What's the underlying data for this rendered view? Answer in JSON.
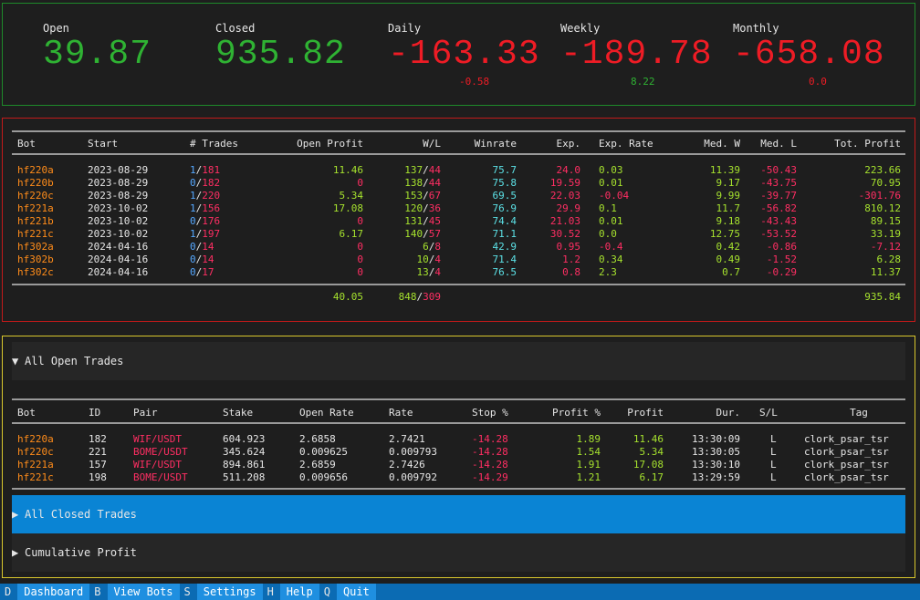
{
  "stats": [
    {
      "label": "Open",
      "value": "39.87",
      "sub": "",
      "color": "#2fb233",
      "sub_color": ""
    },
    {
      "label": "Closed",
      "value": "935.82",
      "sub": "",
      "color": "#2fb233",
      "sub_color": ""
    },
    {
      "label": "Daily",
      "value": "-163.33",
      "sub": "-0.58",
      "color": "#ee1c25",
      "sub_color": "#ee1c25"
    },
    {
      "label": "Weekly",
      "value": "-189.78",
      "sub": "8.22",
      "color": "#ee1c25",
      "sub_color": "#2fb233"
    },
    {
      "label": "Monthly",
      "value": "-658.08",
      "sub": "0.0",
      "color": "#ee1c25",
      "sub_color": "#ee1c25"
    }
  ],
  "bots_table": {
    "headers": [
      "Bot",
      "Start",
      "# Trades",
      "Open Profit",
      "W/L",
      "Winrate",
      "Exp.",
      "Exp. Rate",
      "Med. W",
      "Med. L",
      "Tot. Profit"
    ],
    "rows": [
      {
        "bot": "hf220a",
        "start": "2023-08-29",
        "open": "1",
        "total": "181",
        "open_profit": "11.46",
        "w": "137",
        "l": "44",
        "winrate": "75.7",
        "exp": "24.0",
        "exp_rate": "0.03",
        "med_w": "11.39",
        "med_l": "-50.43",
        "tot": "223.66"
      },
      {
        "bot": "hf220b",
        "start": "2023-08-29",
        "open": "0",
        "total": "182",
        "open_profit": "0",
        "w": "138",
        "l": "44",
        "winrate": "75.8",
        "exp": "19.59",
        "exp_rate": "0.01",
        "med_w": "9.17",
        "med_l": "-43.75",
        "tot": "70.95"
      },
      {
        "bot": "hf220c",
        "start": "2023-08-29",
        "open": "1",
        "total": "220",
        "open_profit": "5.34",
        "w": "153",
        "l": "67",
        "winrate": "69.5",
        "exp": "22.03",
        "exp_rate": "-0.04",
        "med_w": "9.99",
        "med_l": "-39.77",
        "tot": "-301.76"
      },
      {
        "bot": "hf221a",
        "start": "2023-10-02",
        "open": "1",
        "total": "156",
        "open_profit": "17.08",
        "w": "120",
        "l": "36",
        "winrate": "76.9",
        "exp": "29.9",
        "exp_rate": "0.1",
        "med_w": "11.7",
        "med_l": "-56.82",
        "tot": "810.12"
      },
      {
        "bot": "hf221b",
        "start": "2023-10-02",
        "open": "0",
        "total": "176",
        "open_profit": "0",
        "w": "131",
        "l": "45",
        "winrate": "74.4",
        "exp": "21.03",
        "exp_rate": "0.01",
        "med_w": "9.18",
        "med_l": "-43.43",
        "tot": "89.15"
      },
      {
        "bot": "hf221c",
        "start": "2023-10-02",
        "open": "1",
        "total": "197",
        "open_profit": "6.17",
        "w": "140",
        "l": "57",
        "winrate": "71.1",
        "exp": "30.52",
        "exp_rate": "0.0",
        "med_w": "12.75",
        "med_l": "-53.52",
        "tot": "33.19"
      },
      {
        "bot": "hf302a",
        "start": "2024-04-16",
        "open": "0",
        "total": "14",
        "open_profit": "0",
        "w": "6",
        "l": "8",
        "winrate": "42.9",
        "exp": "0.95",
        "exp_rate": "-0.4",
        "med_w": "0.42",
        "med_l": "-0.86",
        "tot": "-7.12"
      },
      {
        "bot": "hf302b",
        "start": "2024-04-16",
        "open": "0",
        "total": "14",
        "open_profit": "0",
        "w": "10",
        "l": "4",
        "winrate": "71.4",
        "exp": "1.2",
        "exp_rate": "0.34",
        "med_w": "0.49",
        "med_l": "-1.52",
        "tot": "6.28"
      },
      {
        "bot": "hf302c",
        "start": "2024-04-16",
        "open": "0",
        "total": "17",
        "open_profit": "0",
        "w": "13",
        "l": "4",
        "winrate": "76.5",
        "exp": "0.8",
        "exp_rate": "2.3",
        "med_w": "0.7",
        "med_l": "-0.29",
        "tot": "11.37"
      }
    ],
    "totals": {
      "open_profit": "40.05",
      "w": "848",
      "l": "309",
      "tot": "935.84"
    }
  },
  "open_trades": {
    "section_title": "All Open Trades",
    "headers": [
      "Bot",
      "ID",
      "Pair",
      "Stake",
      "Open Rate",
      "Rate",
      "Stop %",
      "Profit %",
      "Profit",
      "Dur.",
      "S/L",
      "Tag"
    ],
    "rows": [
      {
        "bot": "hf220a",
        "id": "182",
        "pair": "WIF/USDT",
        "stake": "604.923",
        "open_rate": "2.6858",
        "rate": "2.7421",
        "stop": "-14.28",
        "profit_pct": "1.89",
        "profit": "11.46",
        "dur": "13:30:09",
        "sl": "L",
        "tag": "clork_psar_tsr"
      },
      {
        "bot": "hf220c",
        "id": "221",
        "pair": "BOME/USDT",
        "stake": "345.624",
        "open_rate": "0.009625",
        "rate": "0.009793",
        "stop": "-14.28",
        "profit_pct": "1.54",
        "profit": "5.34",
        "dur": "13:30:05",
        "sl": "L",
        "tag": "clork_psar_tsr"
      },
      {
        "bot": "hf221a",
        "id": "157",
        "pair": "WIF/USDT",
        "stake": "894.861",
        "open_rate": "2.6859",
        "rate": "2.7426",
        "stop": "-14.28",
        "profit_pct": "1.91",
        "profit": "17.08",
        "dur": "13:30:10",
        "sl": "L",
        "tag": "clork_psar_tsr"
      },
      {
        "bot": "hf221c",
        "id": "198",
        "pair": "BOME/USDT",
        "stake": "511.208",
        "open_rate": "0.009656",
        "rate": "0.009792",
        "stop": "-14.29",
        "profit_pct": "1.21",
        "profit": "6.17",
        "dur": "13:29:59",
        "sl": "L",
        "tag": "clork_psar_tsr"
      }
    ]
  },
  "closed_trades": {
    "section_title": "All Closed Trades"
  },
  "cumulative": {
    "section_title": "Cumulative Profit"
  },
  "footer": [
    {
      "key": "D",
      "label": "Dashboard"
    },
    {
      "key": "B",
      "label": "View Bots"
    },
    {
      "key": "S",
      "label": "Settings"
    },
    {
      "key": "H",
      "label": "Help"
    },
    {
      "key": "Q",
      "label": "Quit"
    }
  ]
}
